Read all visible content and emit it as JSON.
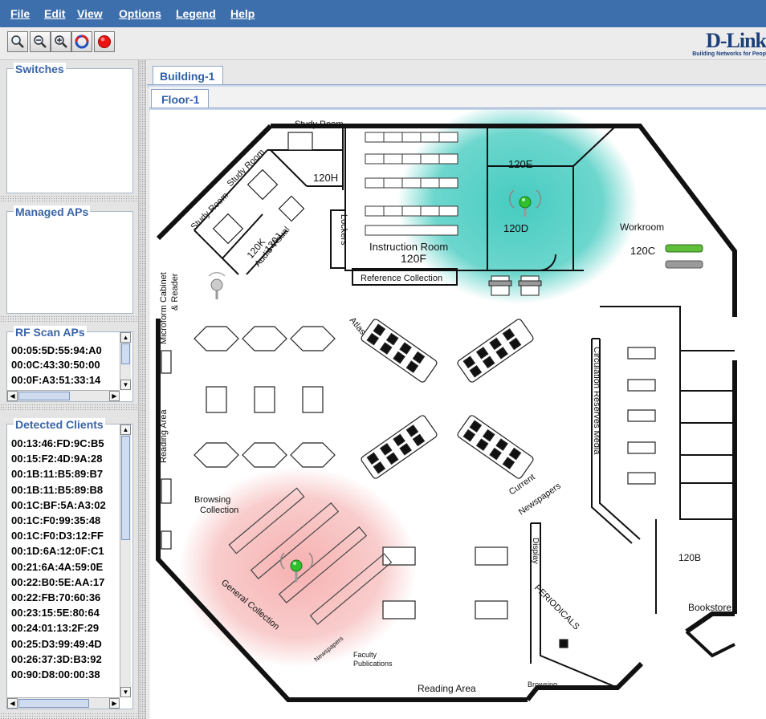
{
  "menu": [
    "File",
    "Edit",
    "View",
    "Options",
    "Legend",
    "Help"
  ],
  "toolbar": {
    "buttons": [
      "zoom-fit-icon",
      "zoom-out-icon",
      "zoom-in-icon",
      "refresh-icon",
      "stop-icon"
    ]
  },
  "logo": {
    "name": "D-Link",
    "tagline": "Building Networks for Peop"
  },
  "panels": {
    "switches": {
      "title": "Switches"
    },
    "managed_aps": {
      "title": "Managed APs"
    },
    "rf_scan_aps": {
      "title": "RF Scan APs",
      "items": [
        "00:05:5D:55:94:A0",
        "00:0C:43:30:50:00",
        "00:0F:A3:51:33:14"
      ]
    },
    "detected_clients": {
      "title": "Detected Clients",
      "items": [
        "00:13:46:FD:9C:B5",
        "00:15:F2:4D:9A:28",
        "00:1B:11:B5:89:B7",
        "00:1B:11:B5:89:B8",
        "00:1C:BF:5A:A3:02",
        "00:1C:F0:99:35:48",
        "00:1C:F0:D3:12:FF",
        "00:1D:6A:12:0F:C1",
        "00:21:6A:4A:59:0E",
        "00:22:B0:5E:AA:17",
        "00:22:FB:70:60:36",
        "00:23:15:5E:80:64",
        "00:24:01:13:2F:29",
        "00:25:D3:99:49:4D",
        "00:26:37:3D:B3:92",
        "00:90:D8:00:00:38"
      ]
    }
  },
  "tabs": {
    "building": "Building-1",
    "floor": "Floor-1"
  },
  "floorplan": {
    "labels": {
      "study_room_top": "Study Room",
      "study_room_1": "Study Room",
      "study_room_2": "Study Room",
      "room_120h": "120H",
      "room_120k": "120K",
      "room_120j": "120J",
      "audio_visual": "Audio Visual",
      "lockers": "Lockers",
      "instruction_room": "Instruction Room",
      "room_120f": "120F",
      "reference_collection": "Reference Collection",
      "room_120e": "120E",
      "room_120d": "120D",
      "workroom": "Workroom",
      "room_120c": "120C",
      "microform": "Microform Cabinet",
      "reader": "& Reader",
      "atlas": "Atlas",
      "circulation": "Circulation Reserves Media",
      "reading_area_left": "Reading Area",
      "browsing_collection_1": "Browsing",
      "browsing_collection_2": "Collection",
      "current_newspapers_1": "Current",
      "current_newspapers_2": "Newspapers",
      "general_collection": "General Collection",
      "newspapers": "Newspapers",
      "faculty_1": "Faculty",
      "faculty_2": "Publications",
      "display": "Display",
      "periodicals": "PERIODICALS",
      "room_120b": "120B",
      "bookstore": "Bookstore",
      "reading_area_bottom": "Reading Area",
      "browsing_bottom": "Browsing"
    },
    "colors": {
      "coverage_teal": "#3cc9bd",
      "coverage_red": "#f07070",
      "ap_green": "#2fbf2f",
      "wall": "#111111"
    }
  }
}
